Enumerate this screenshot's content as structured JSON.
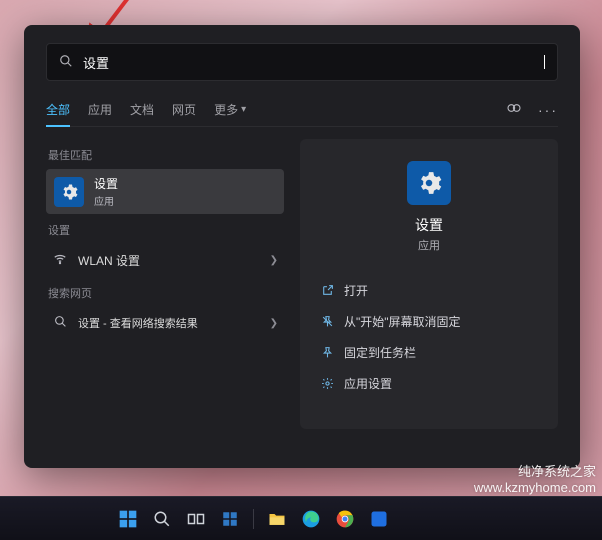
{
  "search": {
    "value": "设置"
  },
  "tabs": {
    "items": [
      "全部",
      "应用",
      "文档",
      "网页",
      "更多"
    ],
    "activeIndex": 0
  },
  "left": {
    "bestMatchHeader": "最佳匹配",
    "bestMatch": {
      "title": "设置",
      "subtitle": "应用"
    },
    "deviceHeader": "设置",
    "wlanItem": "WLAN 设置",
    "webHeader": "搜索网页",
    "webItem": "设置 - 查看网络搜索结果"
  },
  "right": {
    "title": "设置",
    "subtitle": "应用",
    "actions": {
      "open": "打开",
      "unpin": "从\"开始\"屏幕取消固定",
      "pinTaskbar": "固定到任务栏",
      "appSettings": "应用设置"
    }
  },
  "watermark": "纯净系统之家\nwww.kzmyhome.com"
}
